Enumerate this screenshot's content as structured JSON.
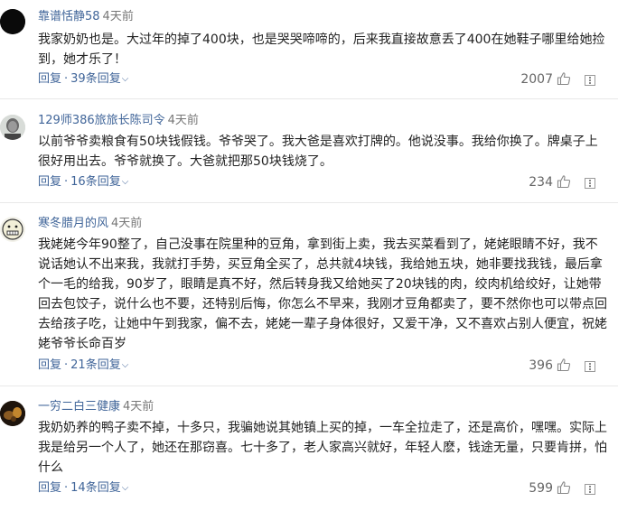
{
  "comments": [
    {
      "username": "靠谱恬静58",
      "time": "4天前",
      "text": "我家奶奶也是。大过年的掉了400块，也是哭哭啼啼的，后来我直接故意丢了400在她鞋子哪里给她捡到，她才乐了！",
      "reply_label": "回复",
      "replies_label": "39条回复",
      "likes": "2007",
      "avatar_icon": "black-circle-avatar"
    },
    {
      "username": "129师386旅旅长陈司令",
      "time": "4天前",
      "text": "以前爷爷卖粮食有50块钱假钱。爷爷哭了。我大爸是喜欢打牌的。他说没事。我给你换了。牌桌子上很好用出去。爷爷就换了。大爸就把那50块钱烧了。",
      "reply_label": "回复",
      "replies_label": "16条回复",
      "likes": "234",
      "avatar_icon": "portrait-avatar"
    },
    {
      "username": "寒冬腊月的风",
      "time": "4天前",
      "text": "我姥姥今年90整了，自己没事在院里种的豆角，拿到街上卖，我去买菜看到了，姥姥眼睛不好，我不说话她认不出来我，我就打手势，买豆角全买了，总共就4块钱，我给她五块，她非要找我钱，最后拿个一毛的给我，90岁了，眼睛是真不好，然后转身我又给她买了20块钱的肉，绞肉机给绞好，让她带回去包饺子，说什么也不要，还特别后悔，你怎么不早来，我刚才豆角都卖了，要不然你也可以带点回去给孩子吃，让她中午到我家，偏不去，姥姥一辈子身体很好，又爱干净，又不喜欢占别人便宜，祝姥姥爷爷长命百岁",
      "reply_label": "回复",
      "replies_label": "21条回复",
      "likes": "396",
      "avatar_icon": "cartoon-face-avatar"
    },
    {
      "username": "一穷二白三健康",
      "time": "4天前",
      "text": "我奶奶养的鸭子卖不掉，十多只，我骗她说其她镇上买的掉，一车全拉走了，还是高价，嘿嘿。实际上我是给另一个人了，她还在那窃喜。七十多了，老人家高兴就好，年轻人麽，钱途无量，只要肯拼，怕什么",
      "reply_label": "回复",
      "replies_label": "14条回复",
      "likes": "599",
      "avatar_icon": "dark-photo-avatar"
    }
  ],
  "colors": {
    "link": "#406599",
    "meta": "#777777",
    "text": "#222222",
    "divider": "#e8e8e8"
  }
}
